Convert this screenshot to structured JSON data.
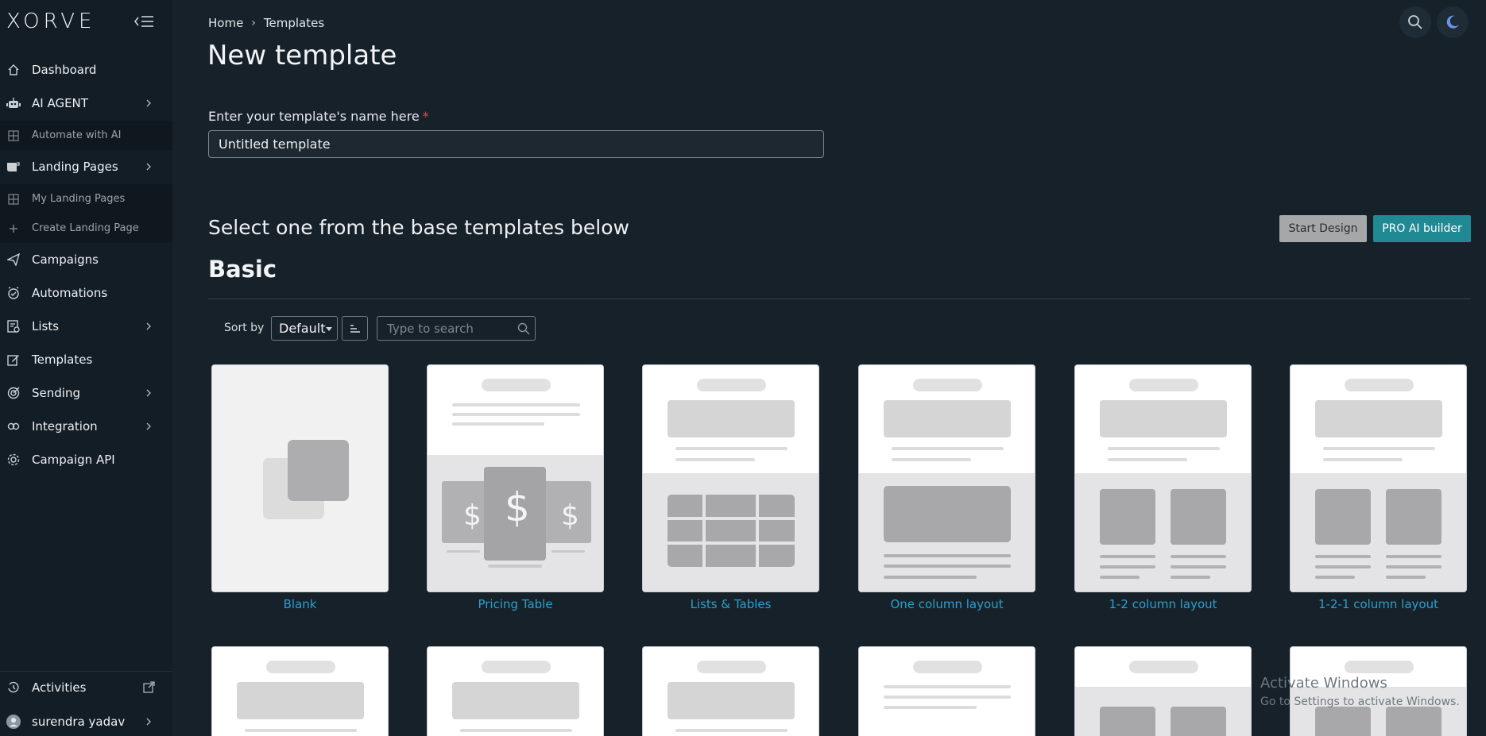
{
  "app": {
    "logo": "XORVE"
  },
  "sidebar": {
    "items": [
      {
        "label": "Dashboard",
        "icon": "home-icon"
      },
      {
        "label": "AI AGENT",
        "icon": "robot-icon"
      },
      {
        "label": "Automate with AI",
        "icon": "grid-icon"
      },
      {
        "label": "Landing Pages",
        "icon": "page-icon"
      },
      {
        "label": "My Landing Pages",
        "icon": "grid-icon"
      },
      {
        "label": "Create Landing Page",
        "icon": "plus-icon"
      },
      {
        "label": "Campaigns",
        "icon": "send-icon"
      },
      {
        "label": "Automations",
        "icon": "alarm-icon"
      },
      {
        "label": "Lists",
        "icon": "list-icon"
      },
      {
        "label": "Templates",
        "icon": "edit-icon"
      },
      {
        "label": "Sending",
        "icon": "target-icon"
      },
      {
        "label": "Integration",
        "icon": "link-icon"
      },
      {
        "label": "Campaign API",
        "icon": "gear-icon"
      },
      {
        "label": "Activities",
        "icon": "history-icon"
      },
      {
        "label": "surendra yadav",
        "icon": "avatar-icon"
      }
    ]
  },
  "breadcrumb": {
    "home": "Home",
    "current": "Templates"
  },
  "page": {
    "title": "New template",
    "name_label": "Enter your template's name here",
    "name_required": "*",
    "name_value": "Untitled template",
    "section_title": "Select one from the base templates below",
    "start_design": "Start Design",
    "pro_builder": "PRO AI builder",
    "category": "Basic"
  },
  "toolbar": {
    "sort_label": "Sort by",
    "sort_value": "Default",
    "search_placeholder": "Type to search"
  },
  "templates": [
    {
      "label": "Blank"
    },
    {
      "label": "Pricing Table"
    },
    {
      "label": "Lists & Tables"
    },
    {
      "label": "One column layout"
    },
    {
      "label": "1-2 column layout"
    },
    {
      "label": "1-2-1 column layout"
    }
  ],
  "watermark": {
    "line1": "Activate Windows",
    "line2": "Go to Settings to activate Windows."
  },
  "colors": {
    "background": "#172129",
    "sidebar": "#131d25",
    "accent": "#1f8a93",
    "link": "#2aa0cf"
  }
}
